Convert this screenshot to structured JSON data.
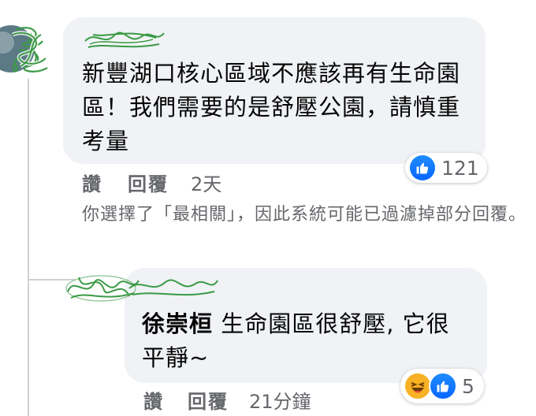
{
  "comment": {
    "text": "新豐湖口核心區域不應該再有生命園區！我們需要的是舒壓公園，請慎重考量",
    "reactions": {
      "icon": "like-icon",
      "count": "121"
    },
    "actions": {
      "like": "讚",
      "reply": "回覆",
      "time": "2天"
    }
  },
  "filter_notice": "你選擇了「最相關」，因此系統可能已過濾掉部分回覆。",
  "reply": {
    "tag_name": "徐崇桓",
    "text": "生命園區很舒壓, 它很平靜~",
    "reactions": {
      "icons": [
        "haha-icon",
        "like-icon"
      ],
      "count": "5"
    },
    "actions": {
      "like": "讚",
      "reply": "回覆",
      "time": "21分鐘"
    }
  },
  "colors": {
    "bubble": "#f0f2f5",
    "secondary_text": "#65676b",
    "like_blue": "#0866ff",
    "haha_yellow": "#f7b125",
    "scribble_green": "#3a9a45"
  }
}
